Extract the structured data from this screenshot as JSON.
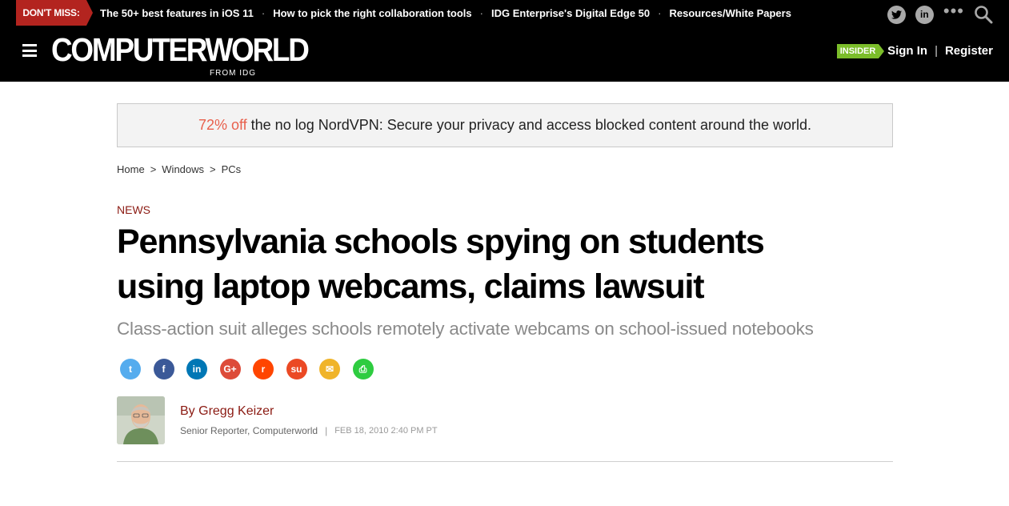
{
  "topbar": {
    "dont_miss_label": "DON'T MISS:",
    "promo_links": [
      "The 50+ best features in iOS 11",
      "How to pick the right collaboration tools",
      "IDG Enterprise's Digital Edge 50",
      "Resources/White Papers"
    ],
    "promo_separator": "·",
    "icons": [
      "twitter-icon",
      "linkedin-icon",
      "more-icon",
      "search-icon"
    ],
    "more_glyph": "•••"
  },
  "header": {
    "logo": "COMPUTERWORLD",
    "logo_sub": "FROM IDG",
    "insider_label": "INSIDER",
    "sign_in": "Sign In",
    "auth_separator": "|",
    "register": "Register"
  },
  "ad": {
    "highlight": "72% off",
    "text": "the no log NordVPN: Secure your privacy and access blocked content around the world."
  },
  "breadcrumb": {
    "items": [
      "Home",
      "Windows",
      "PCs"
    ],
    "separator": ">"
  },
  "article": {
    "category": "NEWS",
    "title": "Pennsylvania schools spying on students using laptop webcams, claims lawsuit",
    "subtitle": "Class-action suit alleges schools remotely activate webcams on school-issued notebooks",
    "share_icons": [
      {
        "name": "twitter-share-icon",
        "color": "#55acee",
        "glyph": "t"
      },
      {
        "name": "facebook-share-icon",
        "color": "#3b5998",
        "glyph": "f"
      },
      {
        "name": "linkedin-share-icon",
        "color": "#0077b5",
        "glyph": "in"
      },
      {
        "name": "google-plus-share-icon",
        "color": "#dd4b39",
        "glyph": "G+"
      },
      {
        "name": "reddit-share-icon",
        "color": "#ff4500",
        "glyph": "r"
      },
      {
        "name": "stumbleupon-share-icon",
        "color": "#eb4924",
        "glyph": "su"
      },
      {
        "name": "email-share-icon",
        "color": "#f0b429",
        "glyph": "✉"
      },
      {
        "name": "print-share-icon",
        "color": "#2ecc40",
        "glyph": "⎙"
      }
    ],
    "author": "By Gregg Keizer",
    "author_title": "Senior Reporter, Computerworld",
    "meta_separator": "|",
    "date": "FEB 18, 2010 2:40 PM PT"
  },
  "colors": {
    "brand_red": "#b3241f",
    "insider_green": "#7bbd2a",
    "category_red": "#8b1a12",
    "ad_highlight": "#e8604c"
  }
}
